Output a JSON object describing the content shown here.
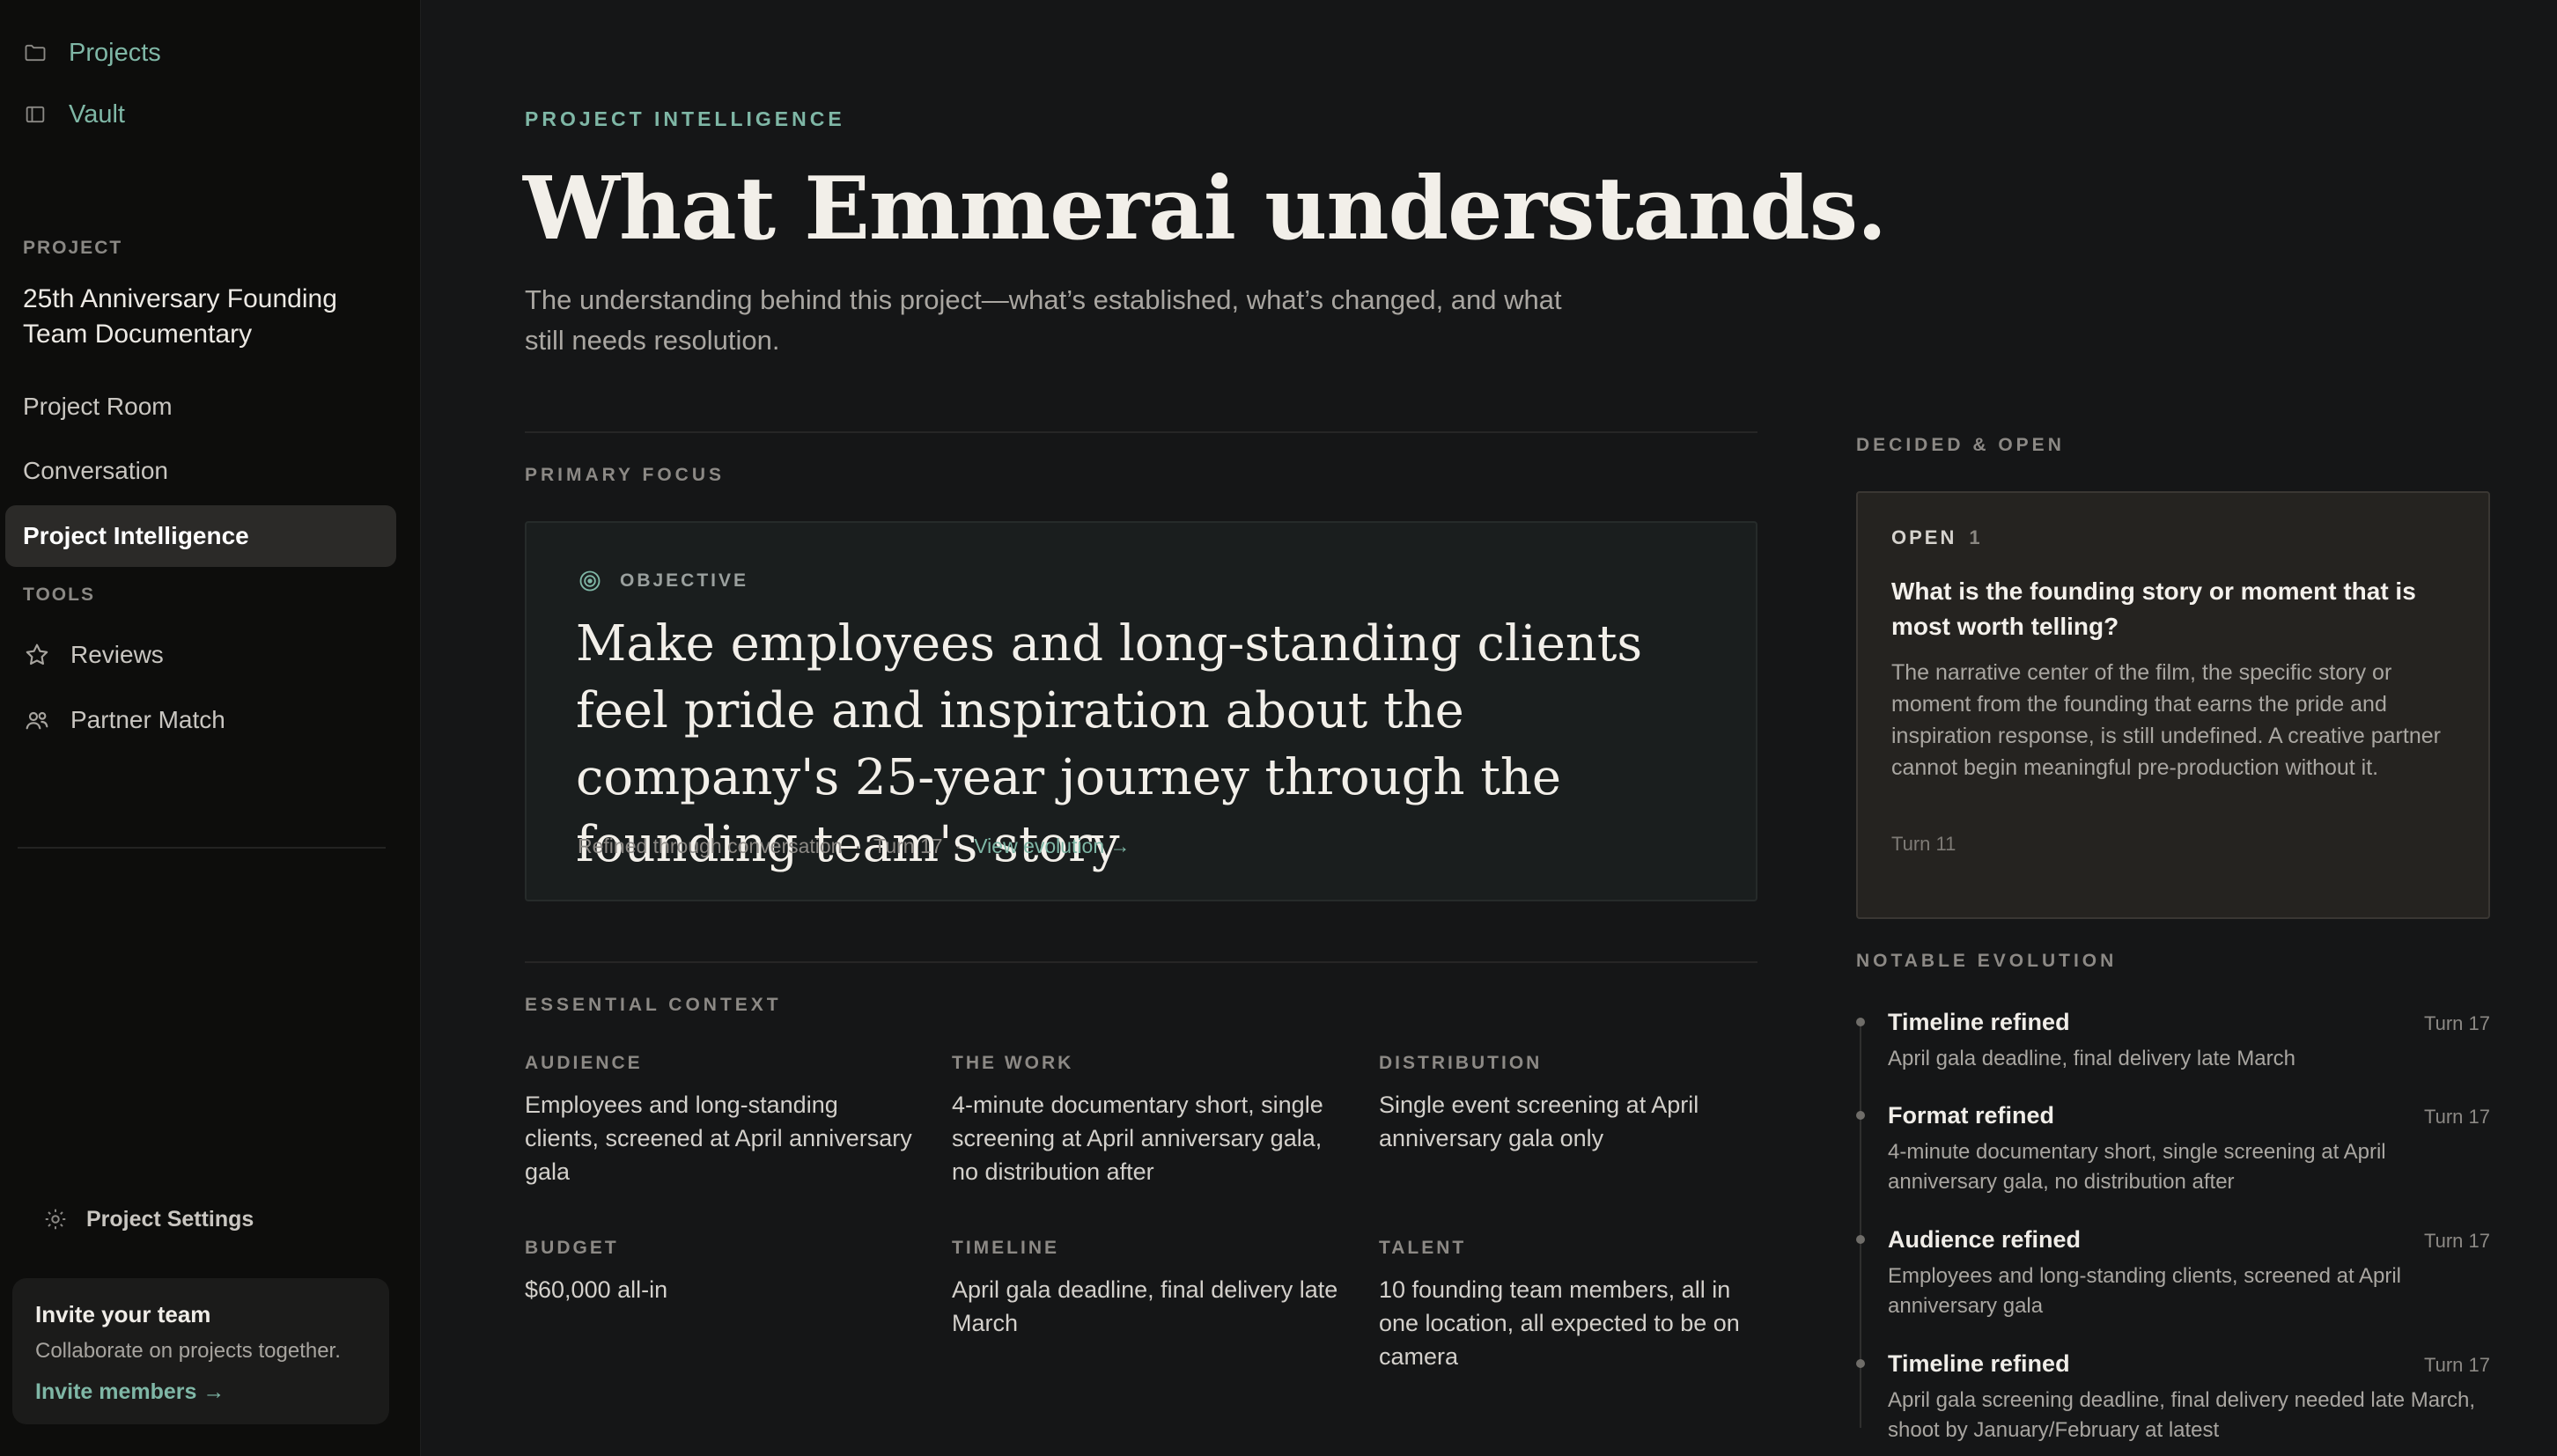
{
  "sidebar": {
    "top_nav": [
      {
        "label": "Projects",
        "icon": "folder-icon"
      },
      {
        "label": "Vault",
        "icon": "sidebar-panel-icon"
      }
    ],
    "project_section_label": "PROJECT",
    "project_name": "25th Anniversary Founding Team Documentary",
    "project_nav": [
      {
        "label": "Project Room"
      },
      {
        "label": "Conversation"
      },
      {
        "label": "Project Intelligence",
        "active": true
      }
    ],
    "tools_section_label": "TOOLS",
    "tools": [
      {
        "label": "Reviews",
        "icon": "star-icon"
      },
      {
        "label": "Partner Match",
        "icon": "users-icon"
      }
    ],
    "settings_label": "Project Settings",
    "invite": {
      "title": "Invite your team",
      "subtitle": "Collaborate on projects together.",
      "link": "Invite members →"
    }
  },
  "main": {
    "eyebrow": "PROJECT INTELLIGENCE",
    "headline": "What Emmerai understands.",
    "subhead": "The understanding behind this project—what’s established, what’s changed, and what still needs resolution.",
    "primary_focus_label": "PRIMARY FOCUS",
    "objective": {
      "label": "OBJECTIVE",
      "text": "Make employees and long-standing clients feel pride and inspiration about the company's 25-year journey through the founding team's story",
      "meta_source": "Refined through conversation",
      "meta_turn": "Turn 17",
      "link": "View evolution →"
    },
    "essential_context_label": "ESSENTIAL CONTEXT",
    "context": [
      {
        "label": "AUDIENCE",
        "value": "Employees and long-standing clients, screened at April anniversary gala"
      },
      {
        "label": "THE WORK",
        "value": "4-minute documentary short, single screening at April anniversary gala, no distribution after"
      },
      {
        "label": "DISTRIBUTION",
        "value": "Single event screening at April anniversary gala only"
      },
      {
        "label": "BUDGET",
        "value": "$60,000 all-in"
      },
      {
        "label": "TIMELINE",
        "value": "April gala deadline, final delivery late March"
      },
      {
        "label": "TALENT",
        "value": "10 founding team members, all in one location, all expected to be on camera"
      }
    ]
  },
  "right": {
    "decided_open_label": "DECIDED & OPEN",
    "open_card": {
      "label": "OPEN",
      "count": "1",
      "question": "What is the founding story or moment that is most worth telling?",
      "description": "The narrative center of the film, the specific story or moment from the founding that earns the pride and inspiration response, is still undefined. A creative partner cannot begin meaningful pre-production without it.",
      "turn": "Turn 11"
    },
    "notable_evolution_label": "NOTABLE EVOLUTION",
    "evolution": [
      {
        "title": "Timeline refined",
        "turn": "Turn 17",
        "desc": "April gala deadline, final delivery late March"
      },
      {
        "title": "Format refined",
        "turn": "Turn 17",
        "desc": "4-minute documentary short, single screening at April anniversary gala, no distribution after"
      },
      {
        "title": "Audience refined",
        "turn": "Turn 17",
        "desc": "Employees and long-standing clients, screened at April anniversary gala"
      },
      {
        "title": "Timeline refined",
        "turn": "Turn 17",
        "desc": "April gala screening deadline, final delivery needed late March, shoot by January/February at latest"
      }
    ]
  },
  "colors": {
    "accent": "#7fb7a6",
    "background": "#151617",
    "sidebar": "#0d0d0c"
  }
}
